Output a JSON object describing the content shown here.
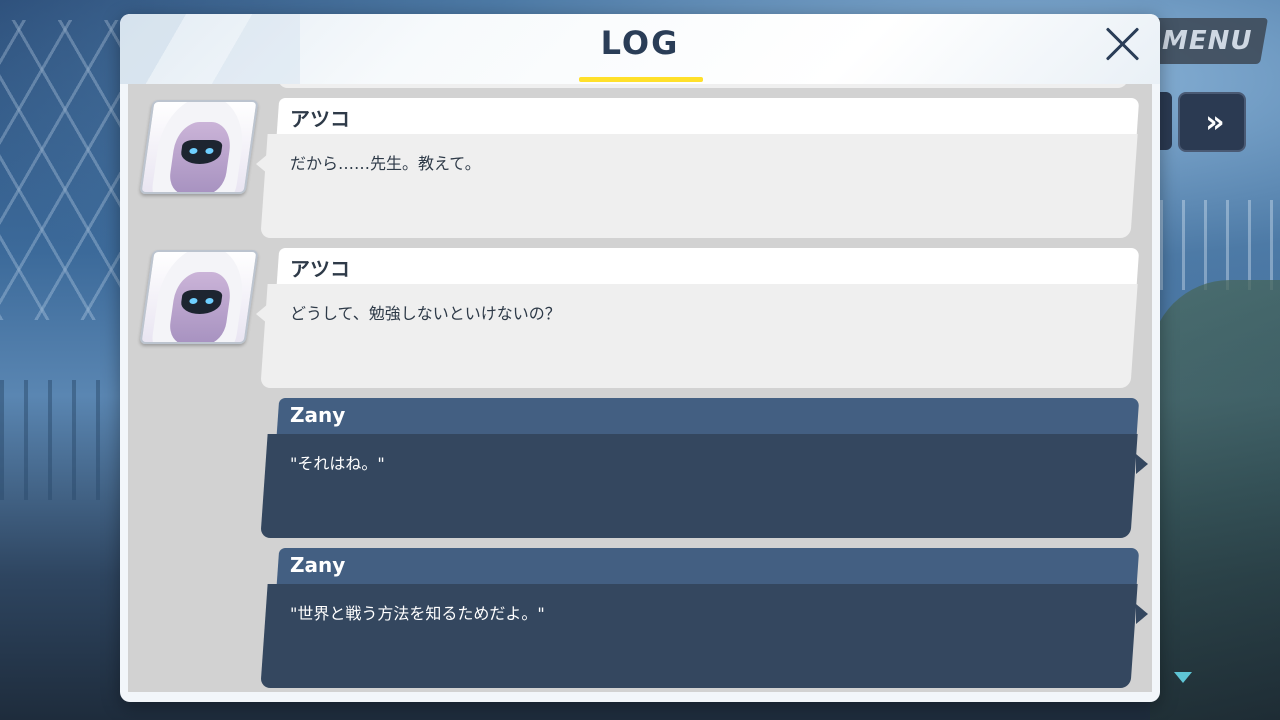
{
  "hud": {
    "menu_label": "MENU",
    "fast_forward_glyph": "»"
  },
  "log": {
    "title": "LOG",
    "close_glyph": "×",
    "entries": [
      {
        "speaker": "アツコ",
        "text": "だから……先生。教えて。",
        "avatar": "atsuko-portrait",
        "side": "npc"
      },
      {
        "speaker": "アツコ",
        "text": "どうして、勉強しないといけないの？",
        "avatar": "atsuko-portrait",
        "side": "npc"
      },
      {
        "speaker": "Zany",
        "text": "\"それはね。\"",
        "side": "player"
      },
      {
        "speaker": "Zany",
        "text": "\"世界と戦う方法を知るためだよ。\"",
        "side": "player"
      }
    ]
  },
  "colors": {
    "accent_underline": "#ffe02a",
    "player_name_bg": "#435f82",
    "player_bubble_bg": "#34475f",
    "npc_bubble_bg": "#efefef",
    "title_color": "#2a3d57"
  }
}
